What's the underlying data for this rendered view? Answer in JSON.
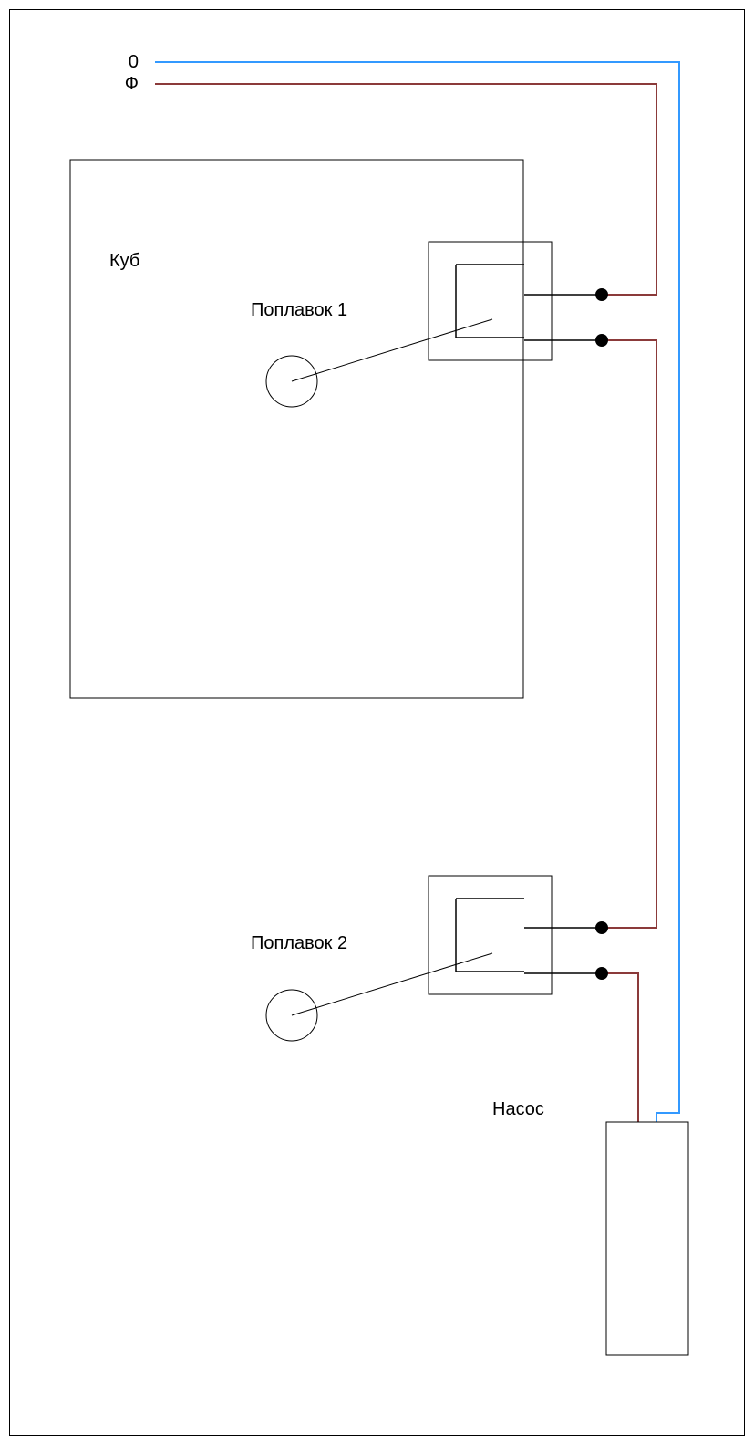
{
  "labels": {
    "neutral": "0",
    "phase": "Ф",
    "tank": "Куб",
    "float1": "Поплавок 1",
    "float2": "Поплавок 2",
    "pump": "Насос"
  },
  "colors": {
    "neutral_wire": "#3399ff",
    "phase_wire": "#8b3a3a",
    "outline": "#000000"
  }
}
